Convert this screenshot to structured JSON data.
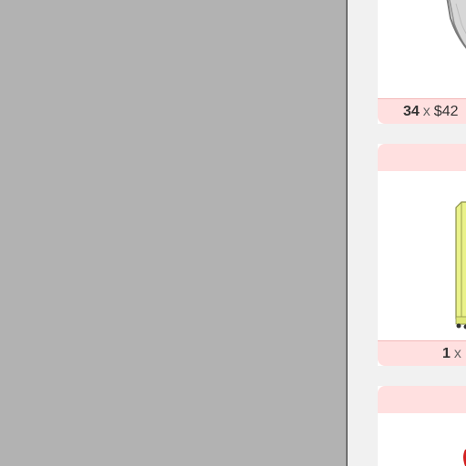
{
  "cards": [
    {
      "item": "storage-tray",
      "quantity": "34",
      "times_symbol": "x",
      "price": "$42"
    },
    {
      "item": "yellow-cabinet",
      "quantity": "1",
      "times_symbol": "x",
      "price": ""
    },
    {
      "item": "red-item"
    }
  ],
  "colors": {
    "viewer_bg": "#b2b2b2",
    "panel_bg": "#f1f1f1",
    "card_band": "#ffe0e0",
    "cabinet_yellow": "#eaf28a",
    "tray_gray": "#9e9e9e",
    "accent_red": "#d32020"
  }
}
